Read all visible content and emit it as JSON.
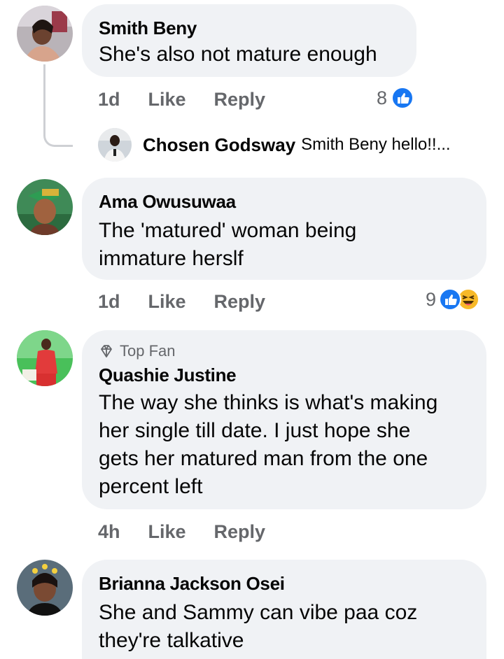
{
  "comments": [
    {
      "author": "Smith Beny",
      "text": "She's also not mature enough",
      "time": "1d",
      "like_label": "Like",
      "reply_label": "Reply",
      "reaction_count": "8",
      "reactions": [
        "like"
      ],
      "replies": [
        {
          "author": "Chosen Godsway",
          "snippet": "Smith Beny hello!!..."
        }
      ]
    },
    {
      "author": "Ama Owusuwaa",
      "text_lines": [
        "The 'matured' woman being",
        "immature herslf"
      ],
      "time": "1d",
      "like_label": "Like",
      "reply_label": "Reply",
      "reaction_count": "9",
      "reactions": [
        "like",
        "haha"
      ]
    },
    {
      "badge": "Top Fan",
      "author": "Quashie Justine",
      "text_lines": [
        "The way she thinks is what's making",
        "her single till date. I just hope she",
        "gets her matured man from the one",
        "percent left"
      ],
      "time": "4h",
      "like_label": "Like",
      "reply_label": "Reply"
    },
    {
      "author": "Brianna Jackson Osei",
      "text_lines": [
        "She and Sammy can vibe paa coz",
        "they're talkative"
      ]
    }
  ],
  "colors": {
    "bubble": "#f0f2f5",
    "meta_text": "#65676b",
    "like_blue": "#1877f2",
    "haha_yellow": "#f7b928"
  },
  "icons": [
    "like-reaction-icon",
    "haha-reaction-icon",
    "top-fan-diamond-icon"
  ]
}
